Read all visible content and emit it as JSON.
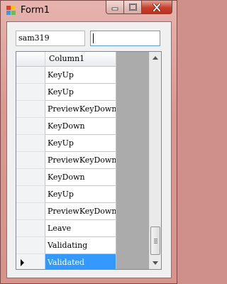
{
  "window": {
    "title": "Form1",
    "icon": "winforms-app-icon",
    "controls": [
      "minimize-icon",
      "maximize-icon",
      "close-icon"
    ]
  },
  "textboxes": [
    {
      "value": "sam319"
    },
    {
      "value": ""
    }
  ],
  "grid": {
    "columns": [
      "Column1"
    ],
    "rows": [
      {
        "value": "KeyUp"
      },
      {
        "value": "KeyUp"
      },
      {
        "value": "PreviewKeyDown"
      },
      {
        "value": "KeyDown"
      },
      {
        "value": "KeyUp"
      },
      {
        "value": "PreviewKeyDown"
      },
      {
        "value": "KeyDown"
      },
      {
        "value": "KeyUp"
      },
      {
        "value": "PreviewKeyDown"
      },
      {
        "value": "Leave"
      },
      {
        "value": "Validating"
      },
      {
        "value": "Validated",
        "selected": true,
        "current": true
      }
    ]
  },
  "colors": {
    "selection": "#3399ff",
    "grid_background": "#ababab",
    "focus_border": "#5aa0d8"
  }
}
